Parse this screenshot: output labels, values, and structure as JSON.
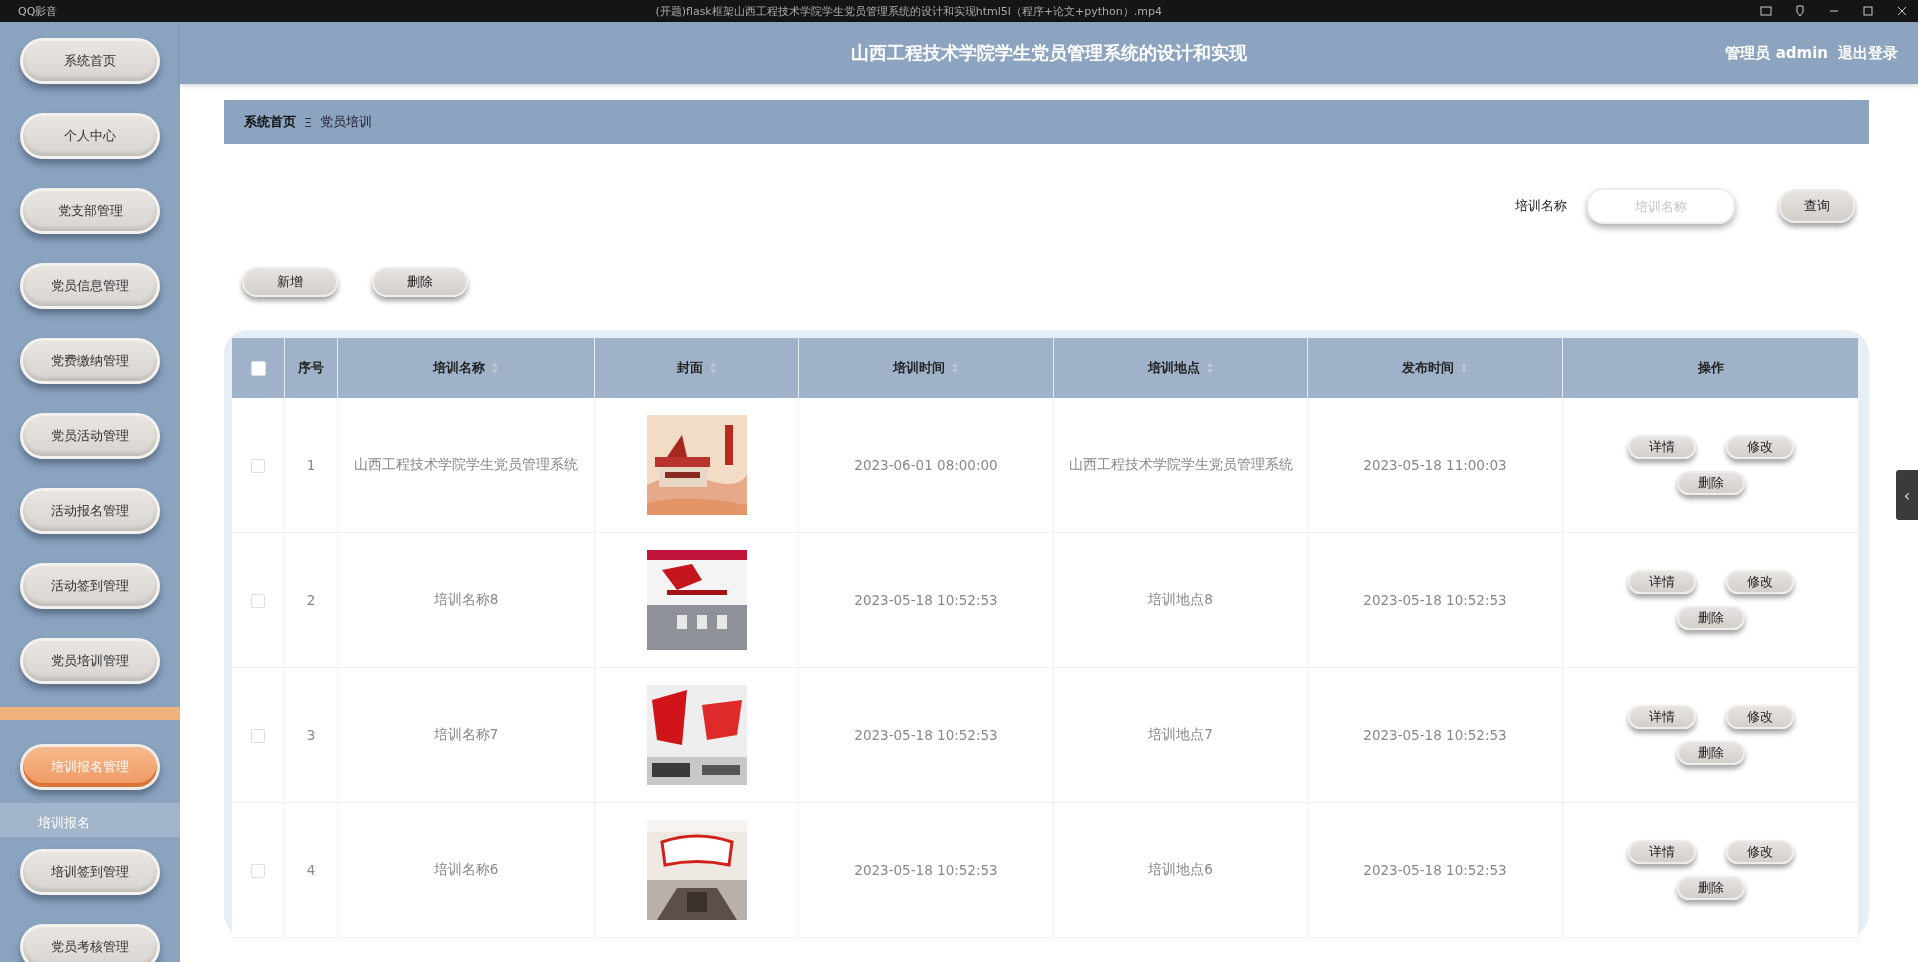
{
  "player": {
    "app_name": "QQ影音",
    "file_title": "(开题)flask框架山西工程技术学院学生党员管理系统的设计和实现html5l（程序+论文+python）.mp4"
  },
  "header": {
    "title": "山西工程技术学院学生党员管理系统的设计和实现",
    "user": "管理员 admin",
    "logout": "退出登录"
  },
  "sidebar": {
    "items": [
      {
        "label": "系统首页",
        "selected": false,
        "expanded": false
      },
      {
        "label": "个人中心",
        "selected": false,
        "expanded": false
      },
      {
        "label": "党支部管理",
        "selected": false,
        "expanded": false
      },
      {
        "label": "党员信息管理",
        "selected": false,
        "expanded": false
      },
      {
        "label": "党费缴纳管理",
        "selected": false,
        "expanded": false
      },
      {
        "label": "党员活动管理",
        "selected": false,
        "expanded": false
      },
      {
        "label": "活动报名管理",
        "selected": false,
        "expanded": false
      },
      {
        "label": "活动签到管理",
        "selected": false,
        "expanded": false
      },
      {
        "label": "党员培训管理",
        "selected": false,
        "expanded": false
      },
      {
        "label": "培训报名管理",
        "selected": true,
        "expanded": true,
        "children": [
          {
            "label": "培训报名"
          }
        ]
      },
      {
        "label": "培训签到管理",
        "selected": false,
        "expanded": false
      },
      {
        "label": "党员考核管理",
        "selected": false,
        "expanded": false
      }
    ]
  },
  "breadcrumb": [
    "系统首页",
    "党员培训"
  ],
  "breadcrumb_separator": "Ξ",
  "search": {
    "label": "培训名称",
    "placeholder": "培训名称",
    "button": "查询"
  },
  "actions": [
    "新增",
    "删除"
  ],
  "table": {
    "select_all": {
      "checked": false
    },
    "columns": [
      {
        "label": "序号",
        "sortable": false
      },
      {
        "label": "培训名称",
        "sortable": true
      },
      {
        "label": "封面",
        "sortable": true
      },
      {
        "label": "培训时间",
        "sortable": true
      },
      {
        "label": "培训地点",
        "sortable": true
      },
      {
        "label": "发布时间",
        "sortable": true
      },
      {
        "label": "操作",
        "sortable": false
      }
    ],
    "rows": [
      {
        "checked": false,
        "index": "1",
        "name": "山西工程技术学院学生党员管理系统",
        "cover": {
          "kind": "picture"
        },
        "time": "2023-06-01 08:00:00",
        "place": "山西工程技术学院学生党员管理系统",
        "published": "2023-05-18 11:00:03",
        "buttons": [
          "详情",
          "修改",
          "删除"
        ]
      },
      {
        "checked": false,
        "index": "2",
        "name": "培训名称8",
        "cover": {
          "kind": "picture"
        },
        "time": "2023-05-18 10:52:53",
        "place": "培训地点8",
        "published": "2023-05-18 10:52:53",
        "buttons": [
          "详情",
          "修改",
          "删除"
        ]
      },
      {
        "checked": false,
        "index": "3",
        "name": "培训名称7",
        "cover": {
          "kind": "picture"
        },
        "time": "2023-05-18 10:52:53",
        "place": "培训地点7",
        "published": "2023-05-18 10:52:53",
        "buttons": [
          "详情",
          "修改",
          "删除"
        ]
      },
      {
        "checked": false,
        "index": "4",
        "name": "培训名称6",
        "cover": {
          "kind": "picture"
        },
        "time": "2023-05-18 10:52:53",
        "place": "培训地点6",
        "published": "2023-05-18 10:52:53",
        "buttons": [
          "详情",
          "修改",
          "删除"
        ]
      }
    ]
  },
  "side_toggle": "‹"
}
